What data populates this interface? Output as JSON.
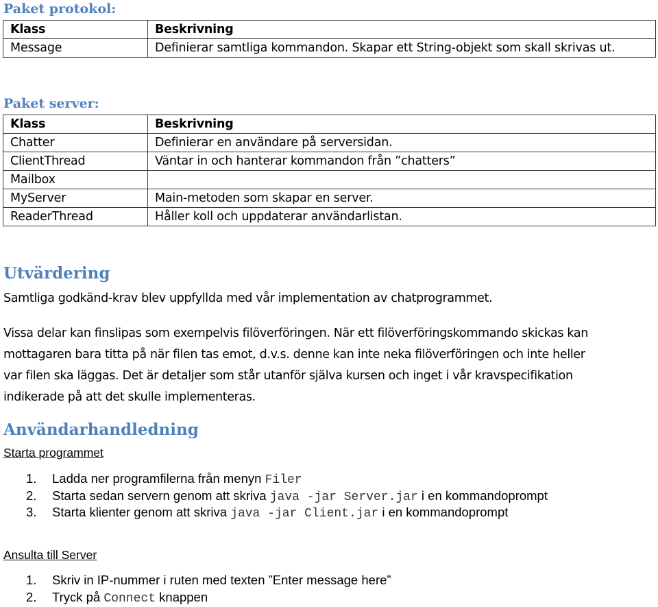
{
  "sections": {
    "protocol": {
      "heading": "Paket protokol:",
      "table": {
        "headers": [
          "Klass",
          "Beskrivning"
        ],
        "rows": [
          [
            "Message",
            "Definierar samtliga kommandon. Skapar ett String-objekt som skall skrivas ut."
          ]
        ]
      }
    },
    "server": {
      "heading": "Paket server:",
      "table": {
        "headers": [
          "Klass",
          "Beskrivning"
        ],
        "rows": [
          [
            "Chatter",
            "Definierar en användare på serversidan."
          ],
          [
            "ClientThread",
            "Väntar in och hanterar kommandon från ”chatters”"
          ],
          [
            "Mailbox",
            ""
          ],
          [
            "MyServer",
            "Main-metoden som skapar en server."
          ],
          [
            "ReaderThread",
            "Håller koll och uppdaterar användarlistan."
          ]
        ]
      }
    },
    "evaluation": {
      "heading": "Utvärdering",
      "paragraph_1": "Samtliga godkänd-krav blev uppfyllda med vår implementation av chatprogrammet.",
      "paragraph_2_lines": [
        "Vissa delar kan finslipas som exempelvis filöverföringen. När ett filöverföringskommando skickas kan",
        "mottagaren bara titta på när filen tas emot, d.v.s. denne kan inte neka filöverföringen och inte heller",
        "var filen ska läggas. Det är detaljer som står utanför själva kursen och inget i vår kravspecifikation",
        "indikerade på att det skulle implementeras."
      ]
    },
    "user_guide": {
      "heading": "Användarhandledning",
      "start": {
        "subheading": "Starta programmet",
        "steps": [
          {
            "num": "1.",
            "text": "Ladda ner programfilerna från menyn ",
            "code": "Filer",
            "suffix": ""
          },
          {
            "num": "2.",
            "text": "Starta sedan servern genom att skriva ",
            "code": "java -jar Server.jar",
            "suffix": " i en kommandoprompt"
          },
          {
            "num": "3.",
            "text": "Starta klienter genom att skriva ",
            "code": "java -jar Client.jar",
            "suffix": " i en kommandoprompt"
          }
        ]
      },
      "connect": {
        "subheading": "Ansulta till Server",
        "steps": [
          {
            "num": "1.",
            "text": "Skriv in IP-nummer i ruten med texten ”Enter message here”",
            "code": "",
            "suffix": ""
          },
          {
            "num": "2.",
            "text": "Tryck på ",
            "code": "Connect",
            "suffix": " knappen"
          }
        ]
      }
    }
  },
  "colors": {
    "heading": "#4f81bd",
    "text": "#000000",
    "table_border": "#333333"
  }
}
